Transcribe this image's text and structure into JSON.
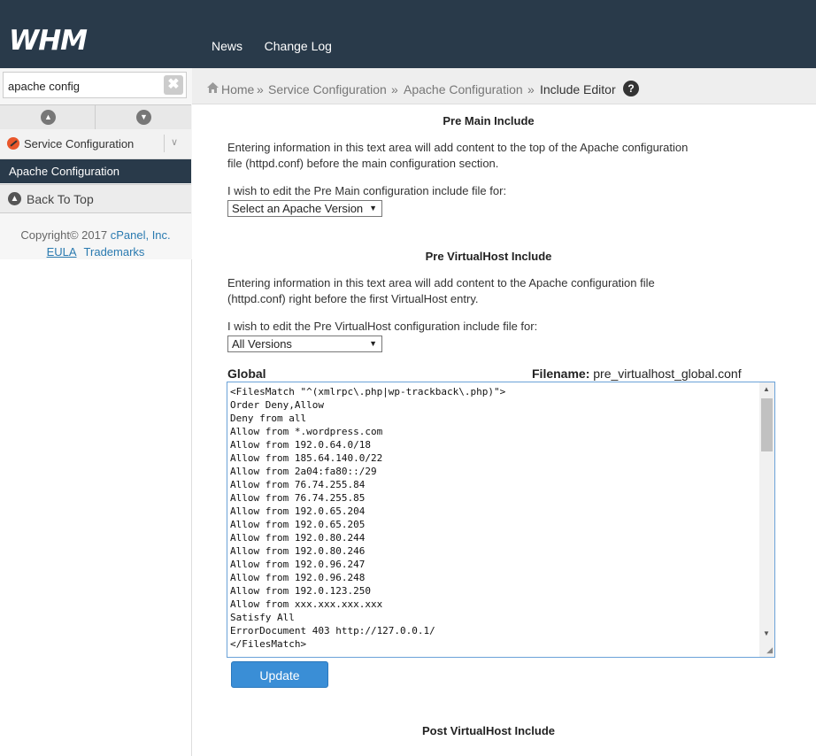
{
  "header": {
    "logo": "WHM",
    "nav": [
      "News",
      "Change Log"
    ]
  },
  "sidebar": {
    "search_value": "apache config",
    "clear_icon": "✖",
    "service_configuration": "Service Configuration",
    "apache_configuration": "Apache Configuration",
    "back_to_top": "Back To Top",
    "copyright": "Copyright© 2017",
    "company": "cPanel, Inc.",
    "eula": "EULA",
    "trademarks": "Trademarks"
  },
  "breadcrumb": {
    "home": "Home",
    "service_configuration": "Service Configuration",
    "apache_configuration": "Apache Configuration",
    "current": "Include Editor",
    "separator": "»"
  },
  "main": {
    "pre_main": {
      "title": "Pre Main Include",
      "desc_line1": "Entering information in this text area will add content to the top of the Apache configuration",
      "desc_line2": "file (httpd.conf) before the main configuration section.",
      "select_label": "I wish to edit the Pre Main configuration include file for:",
      "select_value": "Select an Apache Version"
    },
    "pre_vhost": {
      "title": "Pre VirtualHost Include",
      "desc_line1": "Entering information in this text area will add content to the Apache configuration file",
      "desc_line2": "(httpd.conf) right before the first VirtualHost entry.",
      "select_label": "I wish to edit the Pre VirtualHost configuration include file for:",
      "select_value": "All Versions",
      "global_label": "Global",
      "filename_label": "Filename:",
      "filename_value": "pre_virtualhost_global.conf",
      "code": "<FilesMatch \"^(xmlrpc\\.php|wp-trackback\\.php)\">\nOrder Deny,Allow\nDeny from all\nAllow from *.wordpress.com\nAllow from 192.0.64.0/18\nAllow from 185.64.140.0/22\nAllow from 2a04:fa80::/29\nAllow from 76.74.255.84\nAllow from 76.74.255.85\nAllow from 192.0.65.204\nAllow from 192.0.65.205\nAllow from 192.0.80.244\nAllow from 192.0.80.246\nAllow from 192.0.96.247\nAllow from 192.0.96.248\nAllow from 192.0.123.250\nAllow from xxx.xxx.xxx.xxx\nSatisfy All\nErrorDocument 403 http://127.0.0.1/\n</FilesMatch>",
      "update_button": "Update"
    },
    "post_vhost": {
      "title": "Post VirtualHost Include"
    }
  }
}
